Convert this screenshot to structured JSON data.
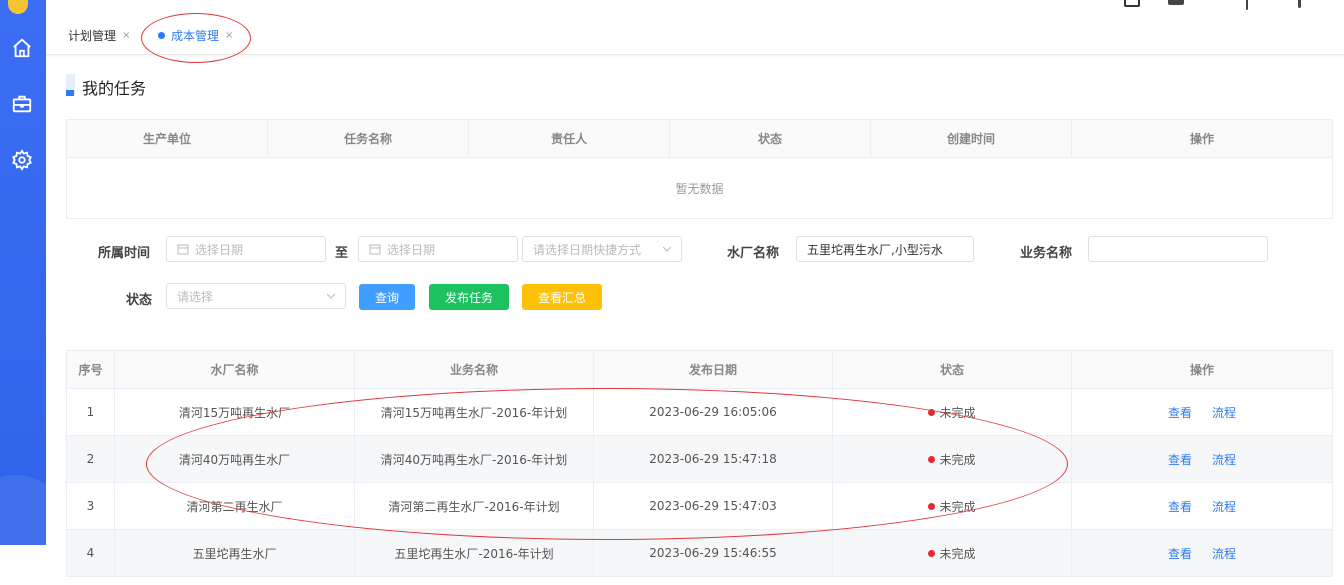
{
  "tabs": [
    {
      "label": "计划管理",
      "close": "×"
    },
    {
      "label": "成本管理",
      "close": "×"
    }
  ],
  "section": {
    "title": "我的任务"
  },
  "task_table": {
    "headers": [
      "生产单位",
      "任务名称",
      "责任人",
      "状态",
      "创建时间",
      "操作"
    ],
    "empty_text": "暂无数据"
  },
  "filters": {
    "time_label": "所属时间",
    "date_from_placeholder": "选择日期",
    "to_label": "至",
    "date_to_placeholder": "选择日期",
    "shortcut_placeholder": "请选择日期快捷方式",
    "plant_label": "水厂名称",
    "plant_value": "五里坨再生水厂,小型污水",
    "business_label": "业务名称",
    "business_value": "",
    "status_label": "状态",
    "status_placeholder": "请选择"
  },
  "buttons": {
    "query": "查询",
    "publish": "发布任务",
    "summary": "查看汇总"
  },
  "colors": {
    "query": "#409eff",
    "publish": "#1ec15f",
    "summary": "#ffc107",
    "accent": "#2d7bf4",
    "annotation": "#e0373a"
  },
  "main_table": {
    "headers": [
      "序号",
      "水厂名称",
      "业务名称",
      "发布日期",
      "状态",
      "操作"
    ],
    "rows": [
      {
        "no": "1",
        "plant": "清河15万吨再生水厂",
        "business": "清河15万吨再生水厂-2016-年计划",
        "date": "2023-06-29 16:05:06",
        "status": "未完成",
        "view": "查看",
        "flow": "流程"
      },
      {
        "no": "2",
        "plant": "清河40万吨再生水厂",
        "business": "清河40万吨再生水厂-2016-年计划",
        "date": "2023-06-29 15:47:18",
        "status": "未完成",
        "view": "查看",
        "flow": "流程"
      },
      {
        "no": "3",
        "plant": "清河第二再生水厂",
        "business": "清河第二再生水厂-2016-年计划",
        "date": "2023-06-29 15:47:03",
        "status": "未完成",
        "view": "查看",
        "flow": "流程"
      },
      {
        "no": "4",
        "plant": "五里坨再生水厂",
        "business": "五里坨再生水厂-2016-年计划",
        "date": "2023-06-29 15:46:55",
        "status": "未完成",
        "view": "查看",
        "flow": "流程"
      }
    ]
  },
  "icons": {
    "sidebar": [
      "home-icon",
      "briefcase-icon",
      "gear-icon"
    ]
  }
}
